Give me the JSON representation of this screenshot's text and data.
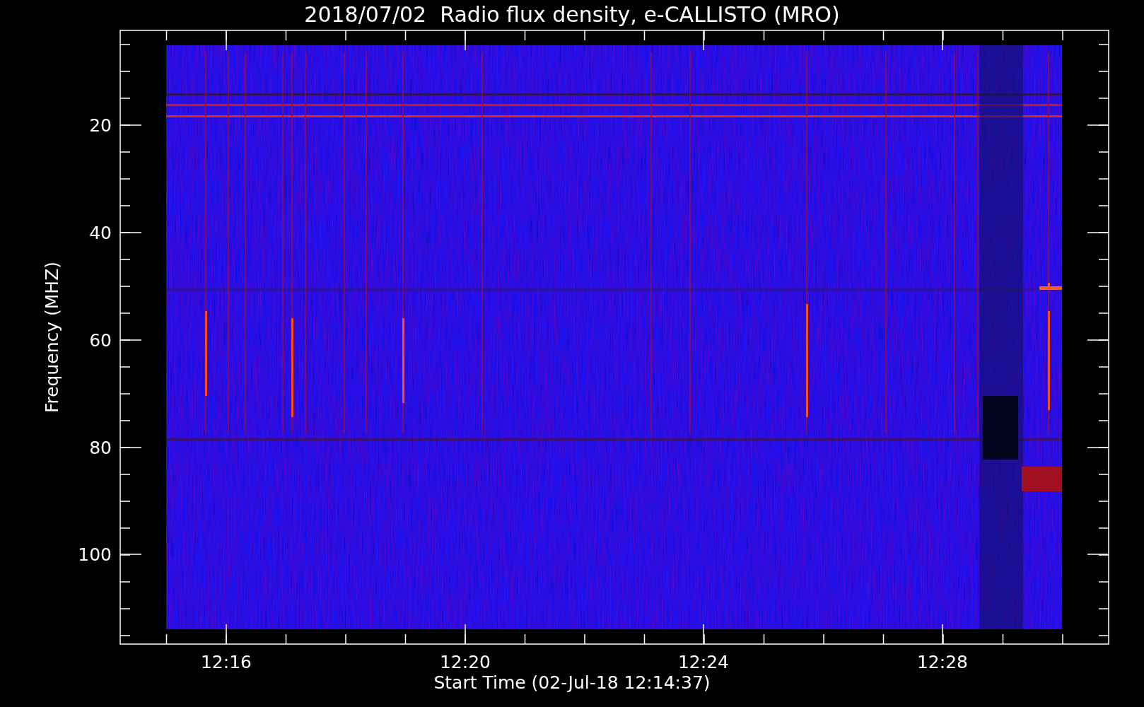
{
  "title": "2018/07/02  Radio flux density, e-CALLISTO (MRO)",
  "plot": {
    "xlabel": "Start Time (02-Jul-18 12:14:37)",
    "ylabel": "Frequency (MHZ)",
    "xtick_labels": [
      "12:16",
      "12:20",
      "12:24",
      "12:28"
    ],
    "ytick_labels": [
      "20",
      "40",
      "60",
      "80",
      "100"
    ]
  }
}
